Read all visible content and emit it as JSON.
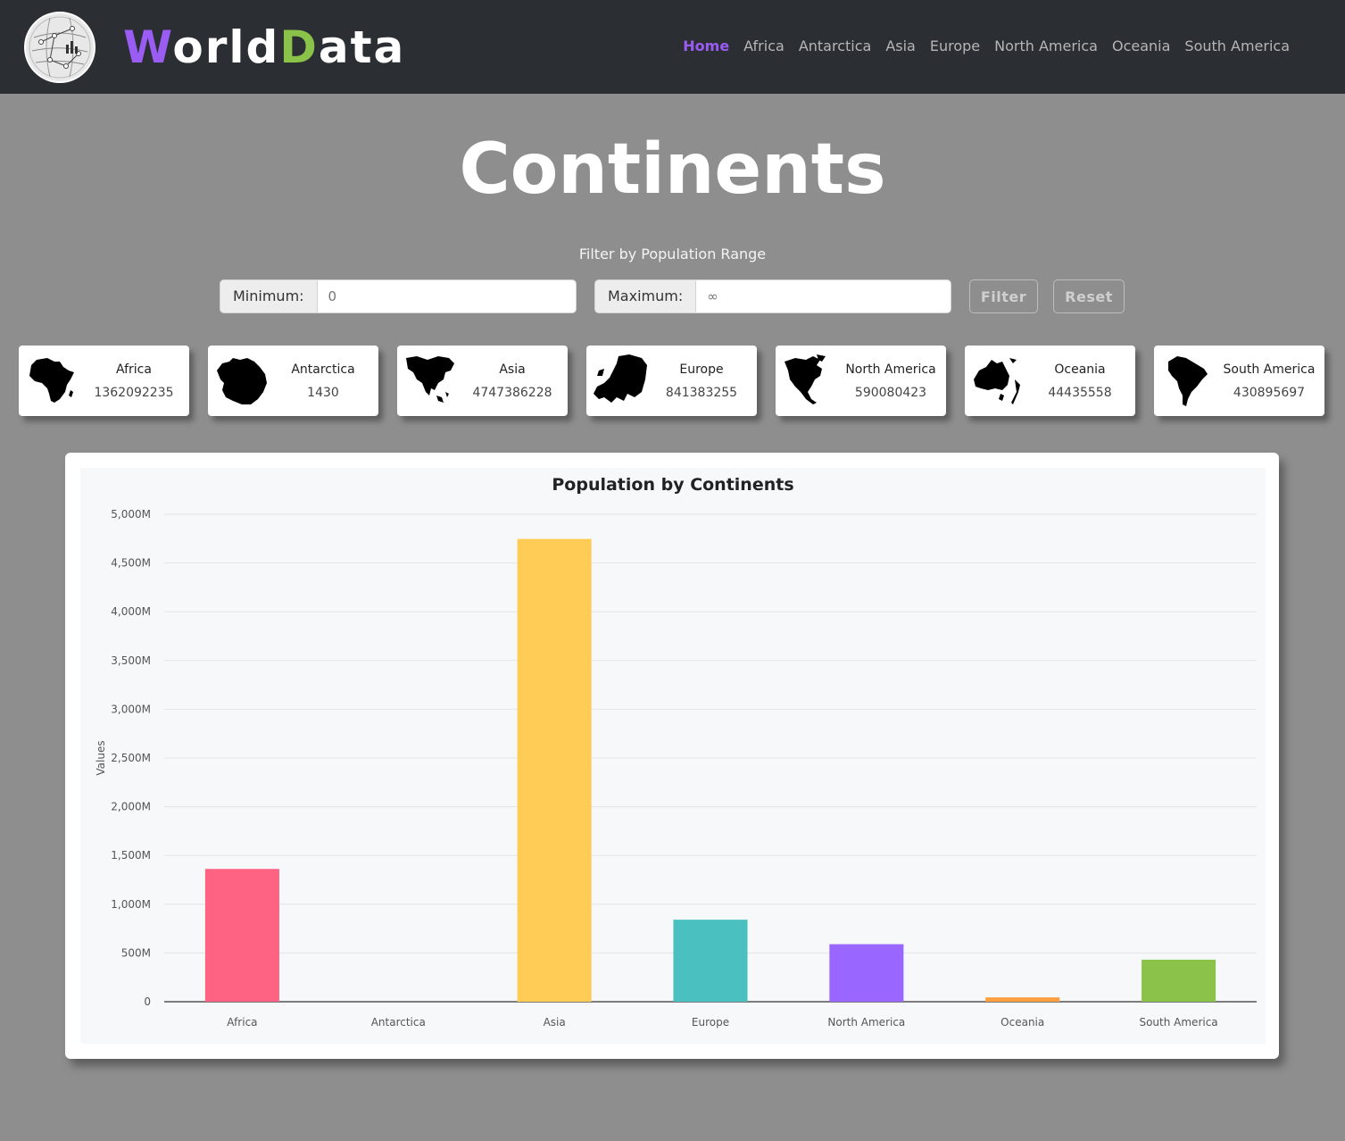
{
  "nav": {
    "brand_w": "W",
    "brand_orld": "orld",
    "brand_d": "D",
    "brand_ata": "ata",
    "links": [
      "Home",
      "Africa",
      "Antarctica",
      "Asia",
      "Europe",
      "North America",
      "Oceania",
      "South America"
    ],
    "active_link": "Home"
  },
  "page": {
    "title": "Continents"
  },
  "filter": {
    "label": "Filter by Population Range",
    "min_label": "Minimum:",
    "min_placeholder": "0",
    "max_label": "Maximum:",
    "max_placeholder": "∞",
    "filter_button": "Filter",
    "reset_button": "Reset"
  },
  "cards": [
    {
      "name": "Africa",
      "value": "1362092235",
      "icon": "africa-silhouette-icon"
    },
    {
      "name": "Antarctica",
      "value": "1430",
      "icon": "antarctica-silhouette-icon"
    },
    {
      "name": "Asia",
      "value": "4747386228",
      "icon": "asia-silhouette-icon"
    },
    {
      "name": "Europe",
      "value": "841383255",
      "icon": "europe-silhouette-icon"
    },
    {
      "name": "North America",
      "value": "590080423",
      "icon": "north-america-silhouette-icon"
    },
    {
      "name": "Oceania",
      "value": "44435558",
      "icon": "oceania-silhouette-icon"
    },
    {
      "name": "South America",
      "value": "430895697",
      "icon": "south-america-silhouette-icon"
    }
  ],
  "colors": {
    "brand_purple": "#9a5cf2",
    "brand_green": "#8bc34a",
    "navbar_bg": "#2b2f33",
    "page_bg": "#8e8e8e"
  },
  "chart_data": {
    "type": "bar",
    "title": "Population by Continents",
    "ylabel": "Values",
    "xlabel": "",
    "categories": [
      "Africa",
      "Antarctica",
      "Asia",
      "Europe",
      "North America",
      "Oceania",
      "South America"
    ],
    "values": [
      1362092235,
      1430,
      4747386228,
      841383255,
      590080423,
      44435558,
      430895697
    ],
    "bar_colors": [
      "#ff6384",
      "#36a2eb",
      "#ffcd56",
      "#4bc0c0",
      "#9966ff",
      "#ff9f40",
      "#8bc34a"
    ],
    "ylim": [
      0,
      5000000000
    ],
    "yticks": [
      0,
      500000000,
      1000000000,
      1500000000,
      2000000000,
      2500000000,
      3000000000,
      3500000000,
      4000000000,
      4500000000,
      5000000000
    ],
    "ytick_labels": [
      "0",
      "500M",
      "1,000M",
      "1,500M",
      "2,000M",
      "2,500M",
      "3,000M",
      "3,500M",
      "4,000M",
      "4,500M",
      "5,000M"
    ],
    "grid": true,
    "legend": "none"
  }
}
